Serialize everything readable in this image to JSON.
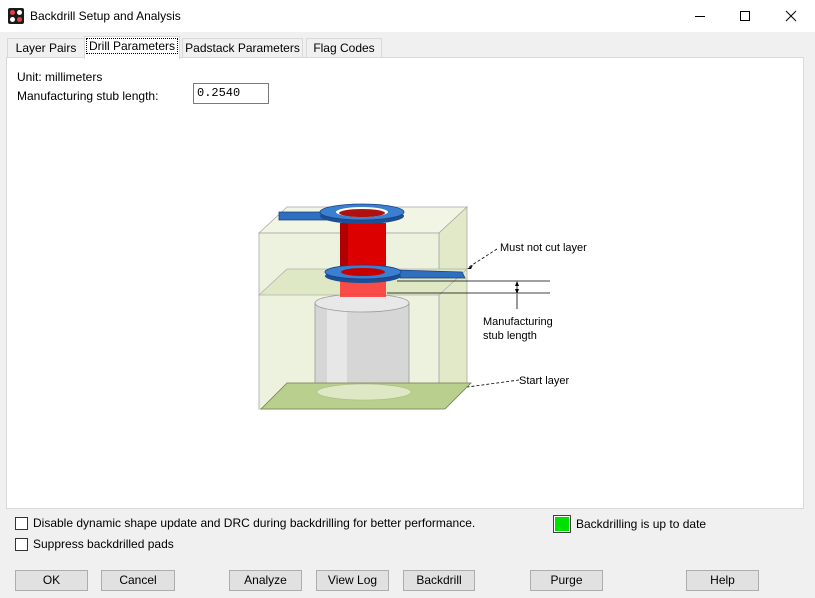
{
  "window": {
    "title": "Backdrill Setup and Analysis",
    "minimize_glyph": "—",
    "maximize_glyph": "☐",
    "close_glyph": "✕"
  },
  "tabs": [
    {
      "label": "Layer Pairs"
    },
    {
      "label": "Drill Parameters"
    },
    {
      "label": "Padstack Parameters"
    },
    {
      "label": "Flag Codes"
    }
  ],
  "active_tab": "Drill Parameters",
  "drill_parameters": {
    "unit_label": "Unit: millimeters",
    "stub_length_label": "Manufacturing stub length:",
    "stub_length_value": "0.2540"
  },
  "diagram": {
    "labels": {
      "must_not_cut": "Must not cut layer",
      "stub_line1": "Manufacturing",
      "stub_line2": "stub length",
      "start_layer": "Start layer"
    },
    "colors": {
      "board": "#e9efd6",
      "copper_pad": "#2e6fbf",
      "barrel": "#d40000",
      "drill": "#d6d6d6",
      "bottom_layer": "#b9cf8d"
    }
  },
  "options": {
    "disable_dynamic_label": "Disable dynamic shape update and DRC during backdrilling for better performance.",
    "disable_dynamic_checked": false,
    "suppress_pads_label": "Suppress backdrilled pads",
    "suppress_pads_checked": false
  },
  "status": {
    "text": "Backdrilling is up to date",
    "color": "#00e000"
  },
  "buttons": {
    "ok": "OK",
    "cancel": "Cancel",
    "analyze": "Analyze",
    "view_log": "View Log",
    "backdrill": "Backdrill",
    "purge": "Purge",
    "help": "Help"
  }
}
